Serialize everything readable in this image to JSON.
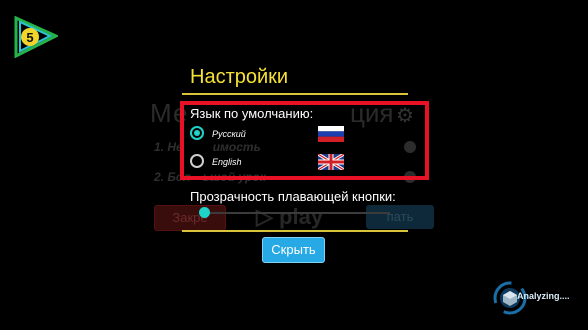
{
  "background": {
    "title_start": "Ме",
    "title_end": "ция",
    "row1": "1. Не",
    "row1_rest": "имость",
    "row2": "2. Бол",
    "row2_rest": "ьшой урок",
    "close_button": "Закре",
    "play_label": "play",
    "right_button": "пать"
  },
  "dialog": {
    "title": "Настройки",
    "language_label": "Язык по умолчанию:",
    "options": [
      {
        "label": "Русский",
        "checked": true,
        "flag": "russia-flag"
      },
      {
        "label": "English",
        "checked": false,
        "flag": "uk-flag"
      }
    ],
    "opacity_label": "Прозрачность плавающей кнопки:",
    "opacity_value": 0.0,
    "hide_button": "Скрыть"
  },
  "overlay": {
    "analyzing_text": "Analyzing....",
    "logo_digit": "5"
  },
  "colors": {
    "accent_teal": "#1fd3c9",
    "title_yellow": "#f6e236",
    "highlight_red": "#e81125",
    "button_blue": "#27a9e6"
  }
}
